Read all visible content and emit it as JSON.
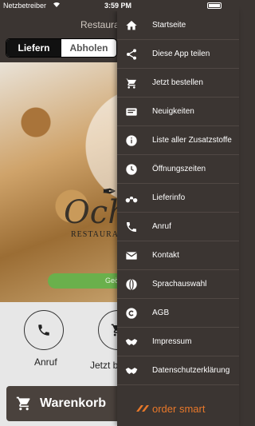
{
  "status": {
    "carrier": "Netzbetreiber",
    "time": "3:59 PM"
  },
  "header": {
    "title": "Restaura"
  },
  "tabs": [
    {
      "label": "Liefern"
    },
    {
      "label": "Abholen"
    }
  ],
  "hero": {
    "logo_text": "Och",
    "logo_sub": "RESTAURAN",
    "pill_text": "Geö"
  },
  "actions": [
    {
      "label": "Anruf"
    },
    {
      "label": "Jetzt b"
    }
  ],
  "cart": {
    "label": "Warenkorb"
  },
  "drawer": {
    "items": [
      {
        "label": "Startseite",
        "icon": "home-icon"
      },
      {
        "label": "Diese App teilen",
        "icon": "share-icon"
      },
      {
        "label": "Jetzt bestellen",
        "icon": "cart-icon"
      },
      {
        "label": "Neuigkeiten",
        "icon": "news-icon"
      },
      {
        "label": "Liste aller Zusatzstoffe",
        "icon": "info-icon"
      },
      {
        "label": "Öffnungszeiten",
        "icon": "clock-icon"
      },
      {
        "label": "Lieferinfo",
        "icon": "motorcycle-icon"
      },
      {
        "label": "Anruf",
        "icon": "phone-icon"
      },
      {
        "label": "Kontakt",
        "icon": "mail-icon"
      },
      {
        "label": "Sprachauswahl",
        "icon": "language-icon"
      },
      {
        "label": "AGB",
        "icon": "copyright-icon"
      },
      {
        "label": "Impressum",
        "icon": "handshake-icon"
      },
      {
        "label": "Datenschutzerklärung",
        "icon": "handshake-icon"
      }
    ],
    "brand": "order smart"
  },
  "colors": {
    "drawer_bg": "#3b3532",
    "brand_orange": "#e8782a",
    "pill_green": "#6ab04c"
  }
}
